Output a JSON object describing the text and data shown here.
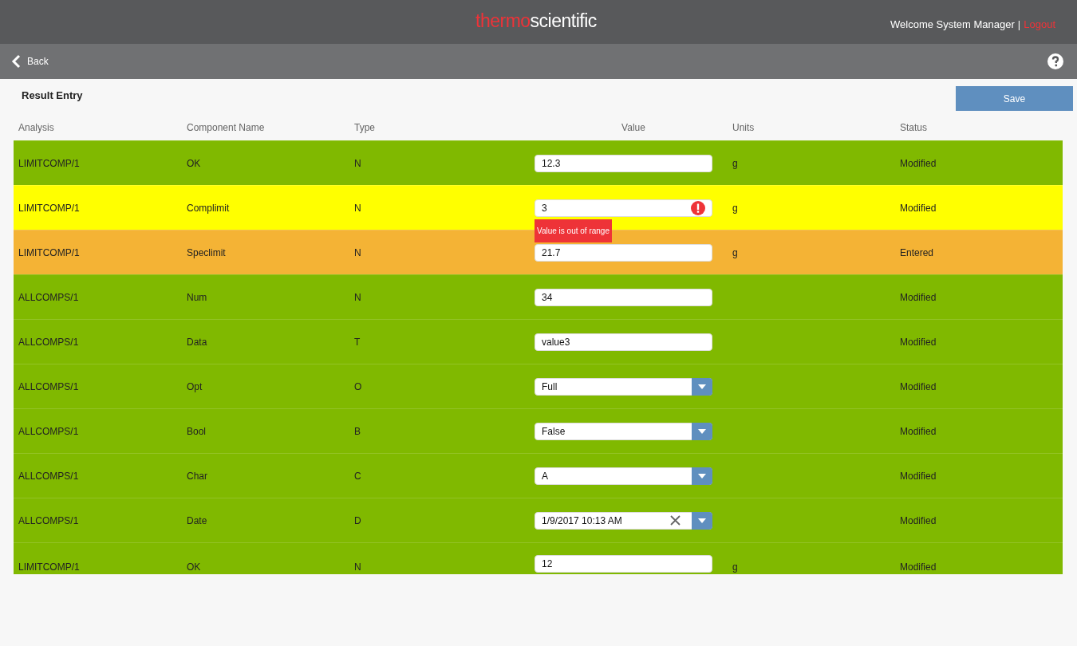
{
  "header": {
    "logo_brand": "thermo",
    "logo_product": "scientific",
    "welcome": "Welcome System Manager",
    "separator": "|",
    "logout": "Logout"
  },
  "nav": {
    "back": "Back"
  },
  "page": {
    "title": "Result Entry",
    "save": "Save"
  },
  "columns": [
    "Analysis",
    "Component Name",
    "Type",
    "Value",
    "Units",
    "Status"
  ],
  "rows": [
    {
      "analysis": "LIMITCOMP/1",
      "component": "OK",
      "type": "N",
      "kind": "text",
      "value": "12.3",
      "units": "g",
      "status": "Modified",
      "color": "#80b900"
    },
    {
      "analysis": "LIMITCOMP/1",
      "component": "Complimit",
      "type": "N",
      "kind": "text",
      "value": "3",
      "units": "g",
      "status": "Modified",
      "color": "#ffff00",
      "error": "Value is out of range"
    },
    {
      "analysis": "LIMITCOMP/1",
      "component": "Speclimit",
      "type": "N",
      "kind": "text",
      "value": "21.7",
      "units": "g",
      "status": "Entered",
      "color": "#f4b335"
    },
    {
      "analysis": "ALLCOMPS/1",
      "component": "Num",
      "type": "N",
      "kind": "text",
      "value": "34",
      "status": "Modified",
      "color": "#80b900"
    },
    {
      "analysis": "ALLCOMPS/1",
      "component": "Data",
      "type": "T",
      "kind": "text",
      "value": "value3",
      "status": "Modified",
      "color": "#80b900"
    },
    {
      "analysis": "ALLCOMPS/1",
      "component": "Opt",
      "type": "O",
      "kind": "select",
      "value": "Full",
      "status": "Modified",
      "color": "#80b900"
    },
    {
      "analysis": "ALLCOMPS/1",
      "component": "Bool",
      "type": "B",
      "kind": "select",
      "value": "False",
      "status": "Modified",
      "color": "#80b900"
    },
    {
      "analysis": "ALLCOMPS/1",
      "component": "Char",
      "type": "C",
      "kind": "select",
      "value": "A",
      "status": "Modified",
      "color": "#80b900"
    },
    {
      "analysis": "ALLCOMPS/1",
      "component": "Date",
      "type": "D",
      "kind": "date",
      "value": "1/9/2017 10:13 AM",
      "status": "Modified",
      "color": "#80b900"
    },
    {
      "analysis": "LIMITCOMP/1",
      "component": "OK",
      "type": "N",
      "kind": "text",
      "value": "12",
      "units": "g",
      "status": "Modified",
      "color": "#80b900"
    }
  ]
}
